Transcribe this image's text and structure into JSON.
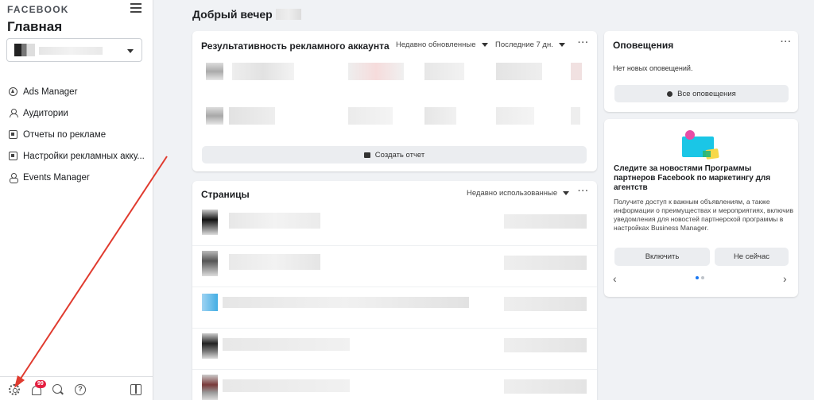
{
  "sidebar": {
    "brand": "FACEBOOK",
    "home_title": "Главная",
    "nav": [
      {
        "label": "Ads Manager",
        "icon": "ads-manager-icon"
      },
      {
        "label": "Аудитории",
        "icon": "audiences-icon"
      },
      {
        "label": "Отчеты по рекламе",
        "icon": "ads-reporting-icon"
      },
      {
        "label": "Настройки рекламных акку...",
        "icon": "ad-account-settings-icon"
      },
      {
        "label": "Events Manager",
        "icon": "events-manager-icon"
      }
    ],
    "bottom": {
      "notification_badge": "99",
      "help_glyph": "?"
    }
  },
  "main": {
    "greeting": "Добрый вечер",
    "ad_performance": {
      "title": "Результативность рекламного аккаунта",
      "filter_sort": "Недавно обновленные",
      "filter_period": "Последние 7 дн.",
      "more": "···",
      "create_report_label": "Создать отчет"
    },
    "pages": {
      "title": "Страницы",
      "filter_sort": "Недавно использованные",
      "more": "···"
    },
    "notifications": {
      "title": "Оповещения",
      "more": "···",
      "empty_text": "Нет новых оповещений.",
      "all_label": "Все оповещения"
    },
    "promo": {
      "title": "Следите за новостями Программы партнеров Facebook по маркетингу для агентств",
      "body": "Получите доступ к важным объявлениям, а также информации о преимуществах и мероприятиях, включив уведомления для новостей партнерской программы в настройках Business Manager.",
      "enable_label": "Включить",
      "not_now_label": "Не сейчас",
      "prev_glyph": "‹",
      "next_glyph": "›"
    }
  },
  "colors": {
    "accent": "#1877f2",
    "annotation_arrow": "#e03b2f",
    "badge": "#e41e3f",
    "background": "#f0f2f5"
  }
}
